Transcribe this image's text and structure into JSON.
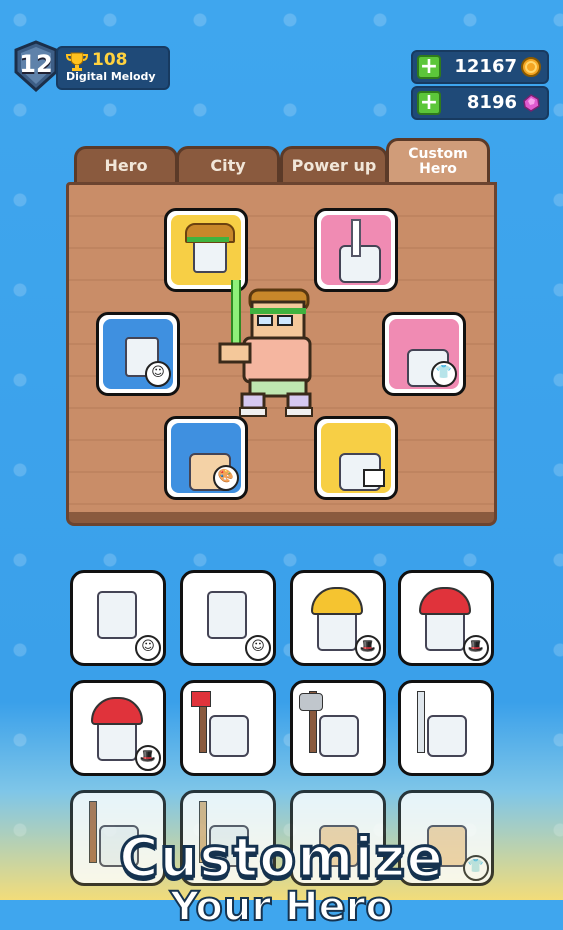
{
  "player": {
    "level": "12",
    "trophies": "108",
    "name": "Digital Melody"
  },
  "currencies": {
    "coins": "12167",
    "gems": "8196"
  },
  "tabs": [
    {
      "label": "Hero"
    },
    {
      "label": "City"
    },
    {
      "label": "Power up"
    },
    {
      "label": "Custom Hero",
      "active": true
    }
  ],
  "hero_slots": [
    {
      "name": "hair",
      "color": "yellow"
    },
    {
      "name": "weapon",
      "color": "pink"
    },
    {
      "name": "face",
      "color": "blue"
    },
    {
      "name": "outfit",
      "color": "pink"
    },
    {
      "name": "skin",
      "color": "blue"
    },
    {
      "name": "pants",
      "color": "yellow"
    }
  ],
  "items_grid": [
    "face-item",
    "face-item",
    "hard-hat",
    "red-cap",
    "red-cap",
    "axe",
    "battle-axe",
    "sword",
    "bat",
    "bat",
    "muscle-outfit",
    "muscle-outfit"
  ],
  "caption": {
    "line1": "Customize",
    "line2": "Your Hero"
  },
  "colors": {
    "sky": "#3fa6ee",
    "wood": "#c98d68",
    "slot_blue": "#3f90e0",
    "slot_yellow": "#f7cf45",
    "slot_pink": "#f08bb3"
  }
}
